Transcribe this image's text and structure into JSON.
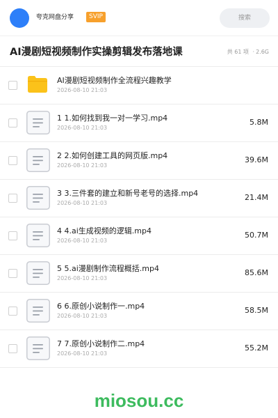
{
  "header": {
    "user_name": "夸克网盘分享",
    "badge": "SVIP",
    "search_placeholder": "搜索"
  },
  "title_bar": {
    "title": "AI漫剧短视频制作实操剪辑发布落地课",
    "item_count": "共 61 项",
    "separator": "·",
    "total_size": "2.6G"
  },
  "files": [
    {
      "type": "folder",
      "name": "AI漫剧短视频制作全流程兴趣教学",
      "date": "2026-08-10 21:03",
      "size": ""
    },
    {
      "type": "file",
      "name": "1 1.如何找到我一对一学习.mp4",
      "date": "2026-08-10 21:03",
      "size": "5.8M"
    },
    {
      "type": "file",
      "name": "2 2.如何创建工具的网页版.mp4",
      "date": "2026-08-10 21:03",
      "size": "39.6M"
    },
    {
      "type": "file",
      "name": "3 3.三件套的建立和新号老号的选择.mp4",
      "date": "2026-08-10 21:03",
      "size": "21.4M"
    },
    {
      "type": "file",
      "name": "4 4.ai生成视频的逻辑.mp4",
      "date": "2026-08-10 21:03",
      "size": "50.7M"
    },
    {
      "type": "file",
      "name": "5 5.ai漫剧制作流程概括.mp4",
      "date": "2026-08-10 21:03",
      "size": "85.6M"
    },
    {
      "type": "file",
      "name": "6 6.原创小说制作一.mp4",
      "date": "2026-08-10 21:03",
      "size": "58.5M"
    },
    {
      "type": "file",
      "name": "7 7.原创小说制作二.mp4",
      "date": "2026-08-10 21:03",
      "size": "55.2M"
    }
  ],
  "watermark": "miosou.cc",
  "colors": {
    "avatar": "#2d7ff9",
    "badge": "#f7a02c",
    "folder": "#fbc21a",
    "watermark": "#3dbb5e"
  },
  "icons": {
    "folder": "folder-icon",
    "file": "document-icon"
  }
}
